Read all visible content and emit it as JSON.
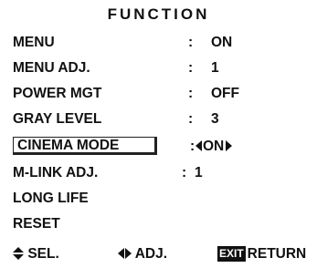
{
  "title": "FUNCTION",
  "menu_items": [
    {
      "label": "MENU",
      "value": "ON"
    },
    {
      "label": "MENU ADJ.",
      "value": "1"
    },
    {
      "label": "POWER MGT",
      "value": "OFF"
    },
    {
      "label": "GRAY LEVEL",
      "value": "3"
    },
    {
      "label": "CINEMA MODE",
      "value": "ON",
      "selected": true
    },
    {
      "label": "M-LINK ADJ.",
      "value": "1"
    },
    {
      "label": "LONG LIFE",
      "value": ""
    },
    {
      "label": "RESET",
      "value": ""
    }
  ],
  "separator": ":",
  "footer": {
    "select_label": "SEL.",
    "adjust_label": "ADJ.",
    "exit_key": "EXIT",
    "return_label": "RETURN"
  },
  "icons": {
    "select": "up-down-arrows-icon",
    "adjust": "left-right-arrows-icon",
    "value_left": "arrow-left-icon",
    "value_right": "arrow-right-icon"
  }
}
